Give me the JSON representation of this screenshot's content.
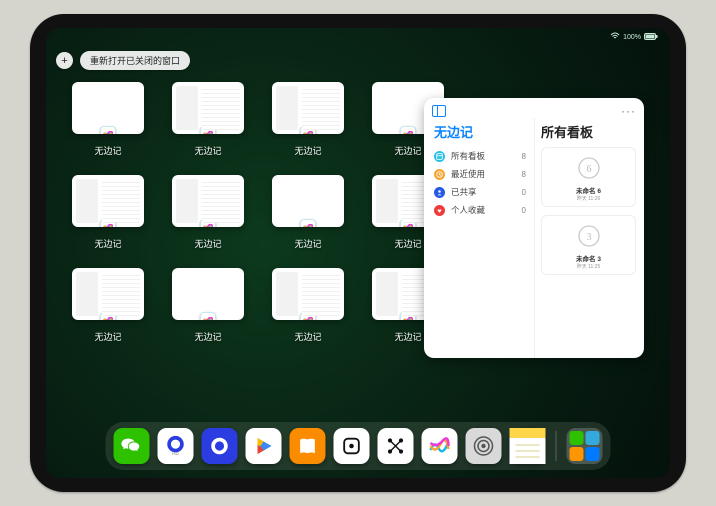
{
  "statusbar": {
    "battery": "100%"
  },
  "buttons": {
    "add": "+",
    "reopen_label": "重新打开已关闭的窗口"
  },
  "app_name": "无边记",
  "app_cards": [
    {
      "label": "无边记",
      "variant": "blank"
    },
    {
      "label": "无边记",
      "variant": "structured"
    },
    {
      "label": "无边记",
      "variant": "structured"
    },
    {
      "label": "无边记",
      "variant": "blank"
    },
    {
      "label": "无边记",
      "variant": "structured"
    },
    {
      "label": "无边记",
      "variant": "structured"
    },
    {
      "label": "无边记",
      "variant": "blank"
    },
    {
      "label": "无边记",
      "variant": "structured"
    },
    {
      "label": "无边记",
      "variant": "structured"
    },
    {
      "label": "无边记",
      "variant": "blank"
    },
    {
      "label": "无边记",
      "variant": "structured"
    },
    {
      "label": "无边记",
      "variant": "structured"
    }
  ],
  "panel": {
    "left_title": "无边记",
    "right_title": "所有看板",
    "more": "···",
    "categories": [
      {
        "name": "所有看板",
        "count": "8",
        "color": "#23c1e6",
        "icon": "boards"
      },
      {
        "name": "最近使用",
        "count": "8",
        "color": "#f6a531",
        "icon": "clock"
      },
      {
        "name": "已共享",
        "count": "0",
        "color": "#2759e8",
        "icon": "person"
      },
      {
        "name": "个人收藏",
        "count": "0",
        "color": "#ef3b3b",
        "icon": "heart"
      }
    ],
    "boards": [
      {
        "caption": "未命名 6",
        "time": "昨天 11:26",
        "digit": "6"
      },
      {
        "caption": "未命名 3",
        "time": "昨天 11:25",
        "digit": "3"
      }
    ]
  },
  "dock": [
    {
      "name": "wechat",
      "bg": "#2dc100",
      "glyph_color": "#fff"
    },
    {
      "name": "quark-hd",
      "bg": "#ffffff",
      "glyph_color": "#2b3de0"
    },
    {
      "name": "quark",
      "bg": "#2b3de0",
      "glyph_color": "#fff"
    },
    {
      "name": "play",
      "bg": "#ffffff",
      "glyph_color": ""
    },
    {
      "name": "books",
      "bg": "#fb8c00",
      "glyph_color": "#fff"
    },
    {
      "name": "dice",
      "bg": "#ffffff",
      "glyph_color": "#111"
    },
    {
      "name": "grid",
      "bg": "#ffffff",
      "glyph_color": "#111"
    },
    {
      "name": "freeform",
      "bg": "#ffffff",
      "glyph_color": ""
    },
    {
      "name": "settings",
      "bg": "#d9d9d9",
      "glyph_color": "#555"
    },
    {
      "name": "notes",
      "bg": "#fff29a",
      "glyph_color": ""
    }
  ]
}
